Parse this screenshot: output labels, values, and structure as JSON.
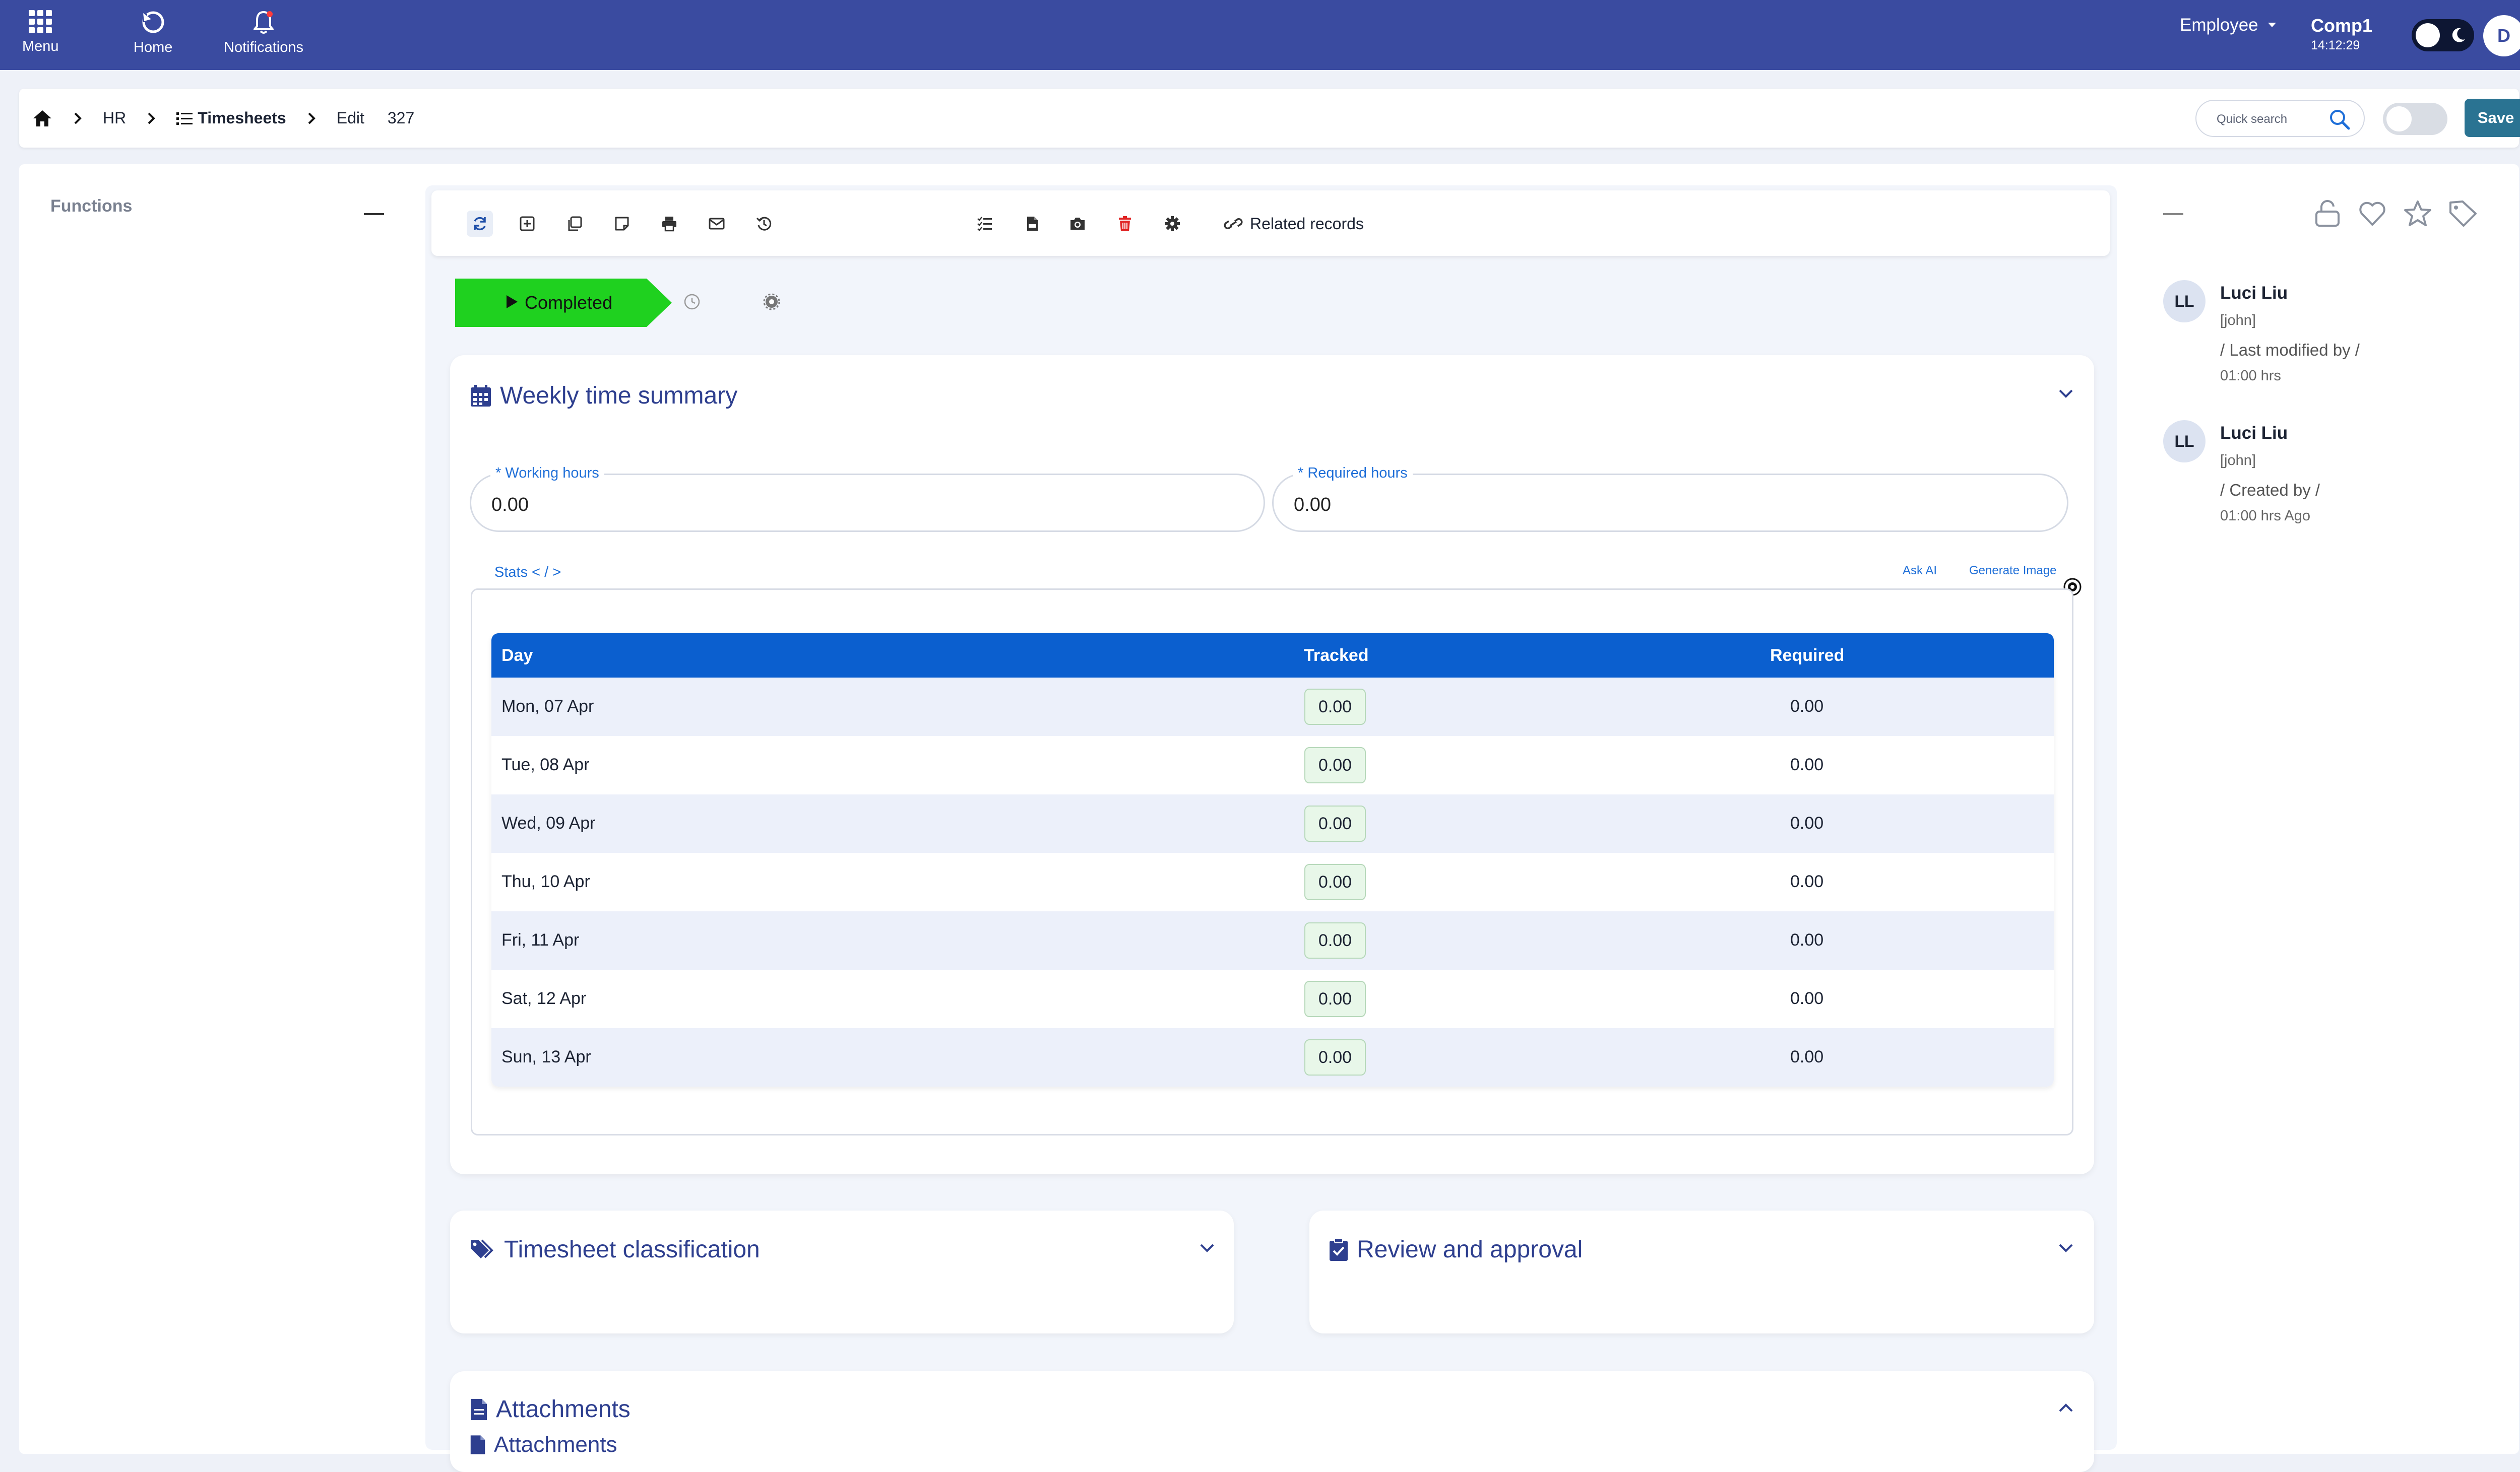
{
  "topnav": {
    "menu_label": "Menu",
    "home_label": "Home",
    "notifications_label": "Notifications",
    "role": "Employee",
    "company": "Comp1",
    "time": "14:12:29",
    "avatar_initial": "D"
  },
  "breadcrumb": {
    "items": [
      "HR",
      "Timesheets",
      "Edit"
    ],
    "record_id": "327"
  },
  "search": {
    "placeholder": "Quick search"
  },
  "actions": {
    "save_label": "Save"
  },
  "sidebar": {
    "functions_label": "Functions"
  },
  "toolbar": {
    "icons": [
      "refresh-icon",
      "add-icon",
      "copy-icon",
      "note-icon",
      "print-icon",
      "email-icon",
      "history-icon",
      "link-icon",
      "checklist-icon",
      "pdf-icon",
      "camera-icon",
      "delete-icon",
      "settings-icon"
    ],
    "related_records_label": "Related records"
  },
  "status": {
    "label": "Completed",
    "color": "#1fd11f"
  },
  "weekly": {
    "title": "Weekly time summary",
    "working_hours_label": "* Working hours",
    "working_hours_value": "0.00",
    "required_hours_label": "* Required hours",
    "required_hours_value": "0.00",
    "stats_label": "Stats < / >",
    "ask_ai": "Ask AI",
    "generate_image": "Generate Image",
    "table": {
      "headers": [
        "Day",
        "Tracked",
        "Required"
      ],
      "rows": [
        {
          "day": "Mon, 07 Apr",
          "tracked": "0.00",
          "required": "0.00"
        },
        {
          "day": "Tue, 08 Apr",
          "tracked": "0.00",
          "required": "0.00"
        },
        {
          "day": "Wed, 09 Apr",
          "tracked": "0.00",
          "required": "0.00"
        },
        {
          "day": "Thu, 10 Apr",
          "tracked": "0.00",
          "required": "0.00"
        },
        {
          "day": "Fri, 11 Apr",
          "tracked": "0.00",
          "required": "0.00"
        },
        {
          "day": "Sat, 12 Apr",
          "tracked": "0.00",
          "required": "0.00"
        },
        {
          "day": "Sun, 13 Apr",
          "tracked": "0.00",
          "required": "0.00"
        }
      ]
    }
  },
  "sections": {
    "classification": "Timesheet classification",
    "review": "Review and approval",
    "attachments": "Attachments",
    "attachments_sub": "Attachments"
  },
  "activity": [
    {
      "initials": "LL",
      "name": "Luci Liu",
      "user": "[john]",
      "action": "/ Last modified by /",
      "time": "01:00 hrs"
    },
    {
      "initials": "LL",
      "name": "Luci Liu",
      "user": "[john]",
      "action": "/ Created by /",
      "time": "01:00 hrs Ago"
    }
  ],
  "colors": {
    "nav": "#3a4ba0",
    "accent": "#0b5fcf",
    "save": "#2a7392",
    "title": "#2e3f8f"
  }
}
